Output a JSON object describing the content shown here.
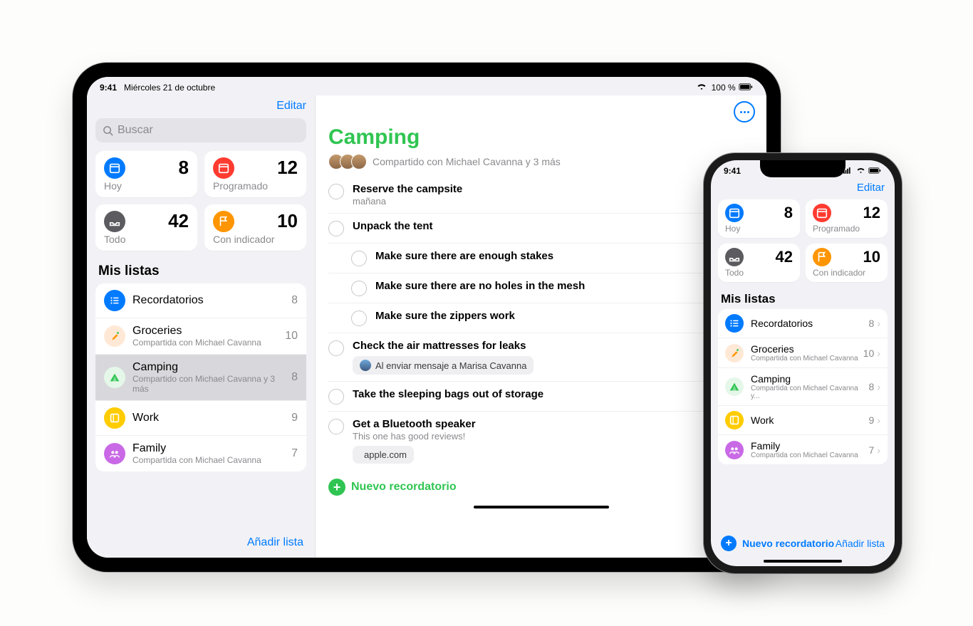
{
  "ipad": {
    "status": {
      "time": "9:41",
      "date": "Miércoles 21 de octubre",
      "battery": "100 %"
    },
    "sidebar": {
      "editar": "Editar",
      "search_placeholder": "Buscar",
      "cards": [
        {
          "label": "Hoy",
          "count": "8",
          "color": "bg-blue",
          "icon": "calendar"
        },
        {
          "label": "Programado",
          "count": "12",
          "color": "bg-red",
          "icon": "calendar"
        },
        {
          "label": "Todo",
          "count": "42",
          "color": "bg-gray",
          "icon": "tray"
        },
        {
          "label": "Con indicador",
          "count": "10",
          "color": "bg-orange",
          "icon": "flag"
        }
      ],
      "section": "Mis listas",
      "lists": [
        {
          "name": "Recordatorios",
          "sub": "",
          "count": "8",
          "color": "bg-blue",
          "icon": "list"
        },
        {
          "name": "Groceries",
          "sub": "Compartida con Michael Cavanna",
          "count": "10",
          "color": "bg-lorange",
          "icon": "carrot"
        },
        {
          "name": "Camping",
          "sub": "Compartido con Michael Cavanna y 3 más",
          "count": "8",
          "color": "bg-lgreen",
          "icon": "tent",
          "selected": true
        },
        {
          "name": "Work",
          "sub": "",
          "count": "9",
          "color": "bg-yellow",
          "icon": "work"
        },
        {
          "name": "Family",
          "sub": "Compartida con Michael Cavanna",
          "count": "7",
          "color": "bg-purple",
          "icon": "family"
        }
      ],
      "add_list": "Añadir lista"
    },
    "main": {
      "title": "Camping",
      "shared": "Compartido con Michael Cavanna y 3 más",
      "items": [
        {
          "title": "Reserve the campsite",
          "sub": "mañana"
        },
        {
          "title": "Unpack the tent"
        },
        {
          "title": "Make sure there are enough stakes",
          "indent": true
        },
        {
          "title": "Make sure there are no holes in the mesh",
          "indent": true
        },
        {
          "title": "Make sure the zippers work",
          "indent": true
        },
        {
          "title": "Check the air mattresses for leaks",
          "chip_text": "Al enviar mensaje a Marisa Cavanna",
          "chip_avatar": true
        },
        {
          "title": "Take the sleeping bags out of storage"
        },
        {
          "title": "Get a Bluetooth speaker",
          "sub": "This one has good reviews!",
          "chip_text": "apple.com",
          "chip_apple": true
        }
      ],
      "new_reminder": "Nuevo recordatorio"
    }
  },
  "iphone": {
    "status_time": "9:41",
    "editar": "Editar",
    "cards": [
      {
        "label": "Hoy",
        "count": "8",
        "color": "bg-blue"
      },
      {
        "label": "Programado",
        "count": "12",
        "color": "bg-red"
      },
      {
        "label": "Todo",
        "count": "42",
        "color": "bg-gray"
      },
      {
        "label": "Con indicador",
        "count": "10",
        "color": "bg-orange"
      }
    ],
    "section": "Mis listas",
    "lists": [
      {
        "name": "Recordatorios",
        "sub": "",
        "count": "8",
        "color": "bg-blue"
      },
      {
        "name": "Groceries",
        "sub": "Compartida con Michael Cavanna",
        "count": "10",
        "color": "bg-lorange"
      },
      {
        "name": "Camping",
        "sub": "Compartida con Michael Cavanna y...",
        "count": "8",
        "color": "bg-lgreen"
      },
      {
        "name": "Work",
        "sub": "",
        "count": "9",
        "color": "bg-yellow"
      },
      {
        "name": "Family",
        "sub": "Compartida con Michael Cavanna",
        "count": "7",
        "color": "bg-purple"
      }
    ],
    "new_reminder": "Nuevo recordatorio",
    "add_list": "Añadir lista"
  }
}
